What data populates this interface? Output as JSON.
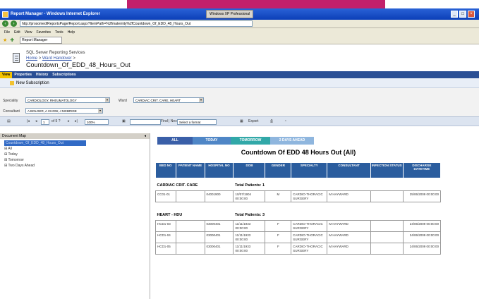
{
  "window": {
    "title": "Report Manager - Windows Internet Explorer",
    "taskbar_tab": "Windows XP Professional"
  },
  "address": {
    "url": "http://prosomed/ReportsPage/Report.aspx?ItemPath=%2fmaternity%2fCountdown_Of_EDD_48_Hours_Out"
  },
  "menu": [
    "File",
    "Edit",
    "View",
    "Favorites",
    "Tools",
    "Help"
  ],
  "favorites": {
    "tab": "Report Manager"
  },
  "header": {
    "product": "SQL Server Reporting Services",
    "breadcrumb_home": "Home",
    "breadcrumb_folder": "Ward Handover",
    "report_title": "Countdown_Of_EDD_48_Hours_Out"
  },
  "report_tabs": [
    "View",
    "Properties",
    "History",
    "Subscriptions"
  ],
  "subscription": {
    "label": "New Subscription"
  },
  "params": {
    "specialty_label": "Speciality",
    "specialty_value": "CARDIOLOGY, RHEUMATOLOGY",
    "ward_label": "Ward",
    "ward_value": "CARDIAC CRIT. CARE, HEART",
    "consultant_label": "Consultant",
    "consultant_value": "A BOLGER, A CHOW, J MCBRIDE"
  },
  "toolbar": {
    "page_label": "of 5 ?",
    "page_current": "1",
    "zoom": "100%",
    "find_label": "Find | Next",
    "format_placeholder": "Select a format",
    "export_label": "Export"
  },
  "docmap": {
    "header": "Document Map",
    "items": [
      "Countdown_Of_EDD_48_Hours_Out",
      "All",
      "Today",
      "Tomorrow",
      "Two Days Ahead"
    ]
  },
  "filters": [
    {
      "label": "ALL",
      "color": "#3a5fa8"
    },
    {
      "label": "TODAY",
      "color": "#4f86c6"
    },
    {
      "label": "TOMORROW",
      "color": "#31a8a8"
    },
    {
      "label": "2 DAYS AHEAD",
      "color": "#8fb6de"
    }
  ],
  "report": {
    "title": "Countdown Of EDD 48 Hours Out (All)",
    "columns": [
      "BED NO",
      "PATIENT NAME",
      "HOSPITAL NO",
      "DOB",
      "GENDER",
      "SPECIALTY",
      "CONSULTANT",
      "INFECTION STATUS",
      "DISCHARGE DATETIME"
    ],
    "total_label": "Total Patients:",
    "groups": [
      {
        "ward": "CARDIAC CRIT. CARE",
        "total": "1",
        "rows": [
          [
            "CC01-01",
            "",
            "04001900",
            "10/07/1904 00:00:00",
            "M",
            "CARDIO-THORACIC SURGERY",
            "M HAYWARD",
            "",
            "25/06/2009 00:00:00"
          ]
        ]
      },
      {
        "ward": "HEART - HDU",
        "total": "3",
        "rows": [
          [
            "HCD1-03",
            "",
            "03000401",
            "11/11/1933 00:00:00",
            "F",
            "CARDIO-THORACIC SURGERY",
            "M HAYWARD",
            "",
            "24/06/2009 00:00:00"
          ],
          [
            "HCD1-04",
            "",
            "03000401",
            "11/11/1933 00:00:00",
            "F",
            "CARDIO-THORACIC SURGERY",
            "M HAYWARD",
            "",
            "24/06/2009 00:00:00"
          ],
          [
            "HCD1-05",
            "",
            "03000401",
            "11/11/1933 00:00:00",
            "F",
            "CARDIO-THORACIC SURGERY",
            "M HAYWARD",
            "",
            "24/06/2009 00:00:00"
          ]
        ]
      }
    ]
  }
}
